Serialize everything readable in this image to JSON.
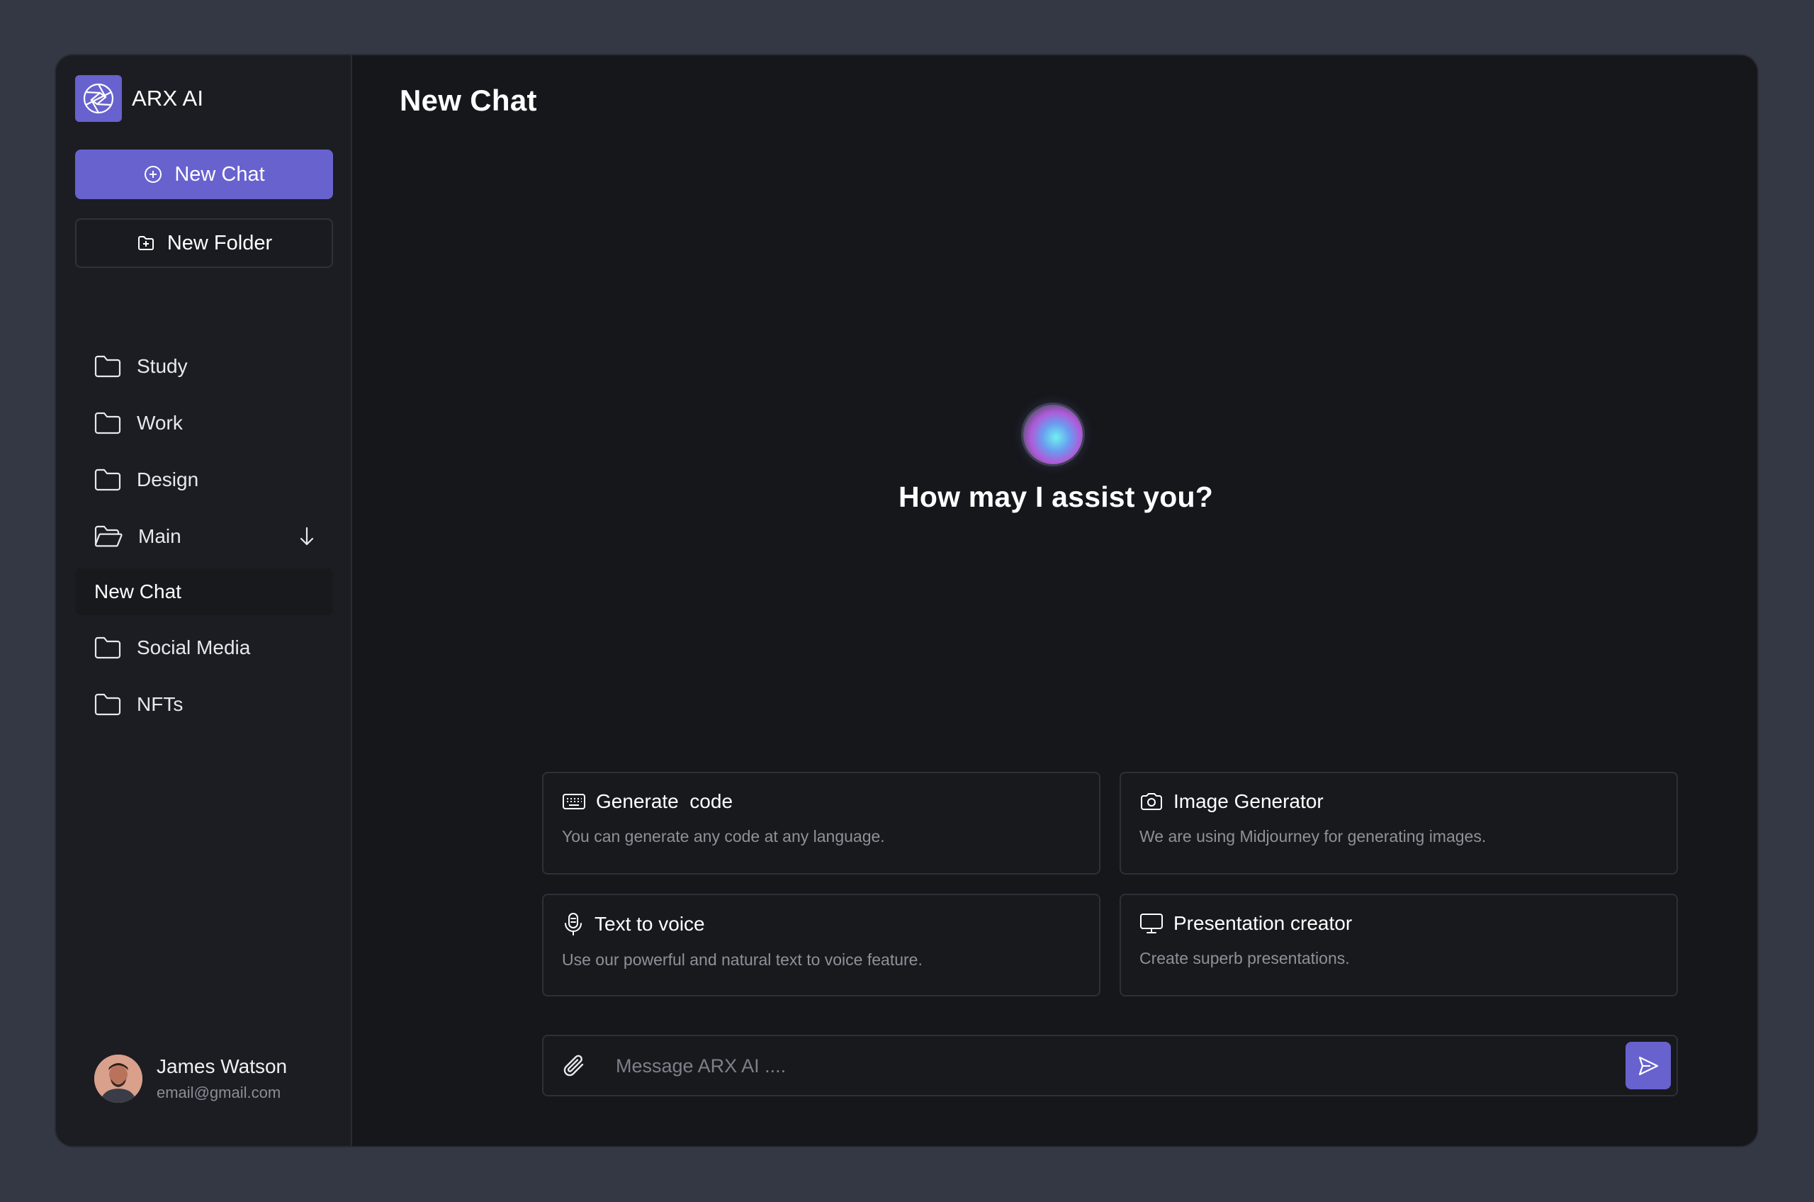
{
  "sidebar": {
    "brand": {
      "name": "ARX AI",
      "logo_icon": "aperture-icon"
    },
    "new_chat_label": "New Chat",
    "new_folder_label": "New Folder",
    "folders": [
      {
        "label": "Study",
        "icon": "folder-icon"
      },
      {
        "label": "Work",
        "icon": "folder-icon"
      },
      {
        "label": "Design",
        "icon": "folder-icon"
      },
      {
        "label": "Main",
        "icon": "folder-open-icon",
        "expanded": true
      },
      {
        "label": "New Chat",
        "icon": ""
      },
      {
        "label": "Social Media",
        "icon": "folder-icon"
      },
      {
        "label": "NFTs",
        "icon": "folder-icon"
      }
    ],
    "user": {
      "name": "James Watson",
      "email": "email@gmail.com"
    }
  },
  "main": {
    "title": "New Chat",
    "greeting": "How may I assist you?",
    "cards": [
      {
        "title": "Generate  code",
        "description": "You can generate any code at any language.",
        "icon": "keyboard-icon"
      },
      {
        "title": "Image Generator",
        "description": "We are using Midjourney for generating images.",
        "icon": "camera-icon"
      },
      {
        "title": "Text to voice",
        "description": "Use our powerful and natural text to voice feature.",
        "icon": "microphone-icon"
      },
      {
        "title": "Presentation creator",
        "description": "Create superb presentations.",
        "icon": "monitor-icon"
      }
    ],
    "composer": {
      "placeholder": "Message ARX AI ....",
      "value": ""
    }
  },
  "colors": {
    "background": "#343844",
    "app": "#16171b",
    "sidebar": "#1c1d22",
    "accent": "#6862cf"
  }
}
